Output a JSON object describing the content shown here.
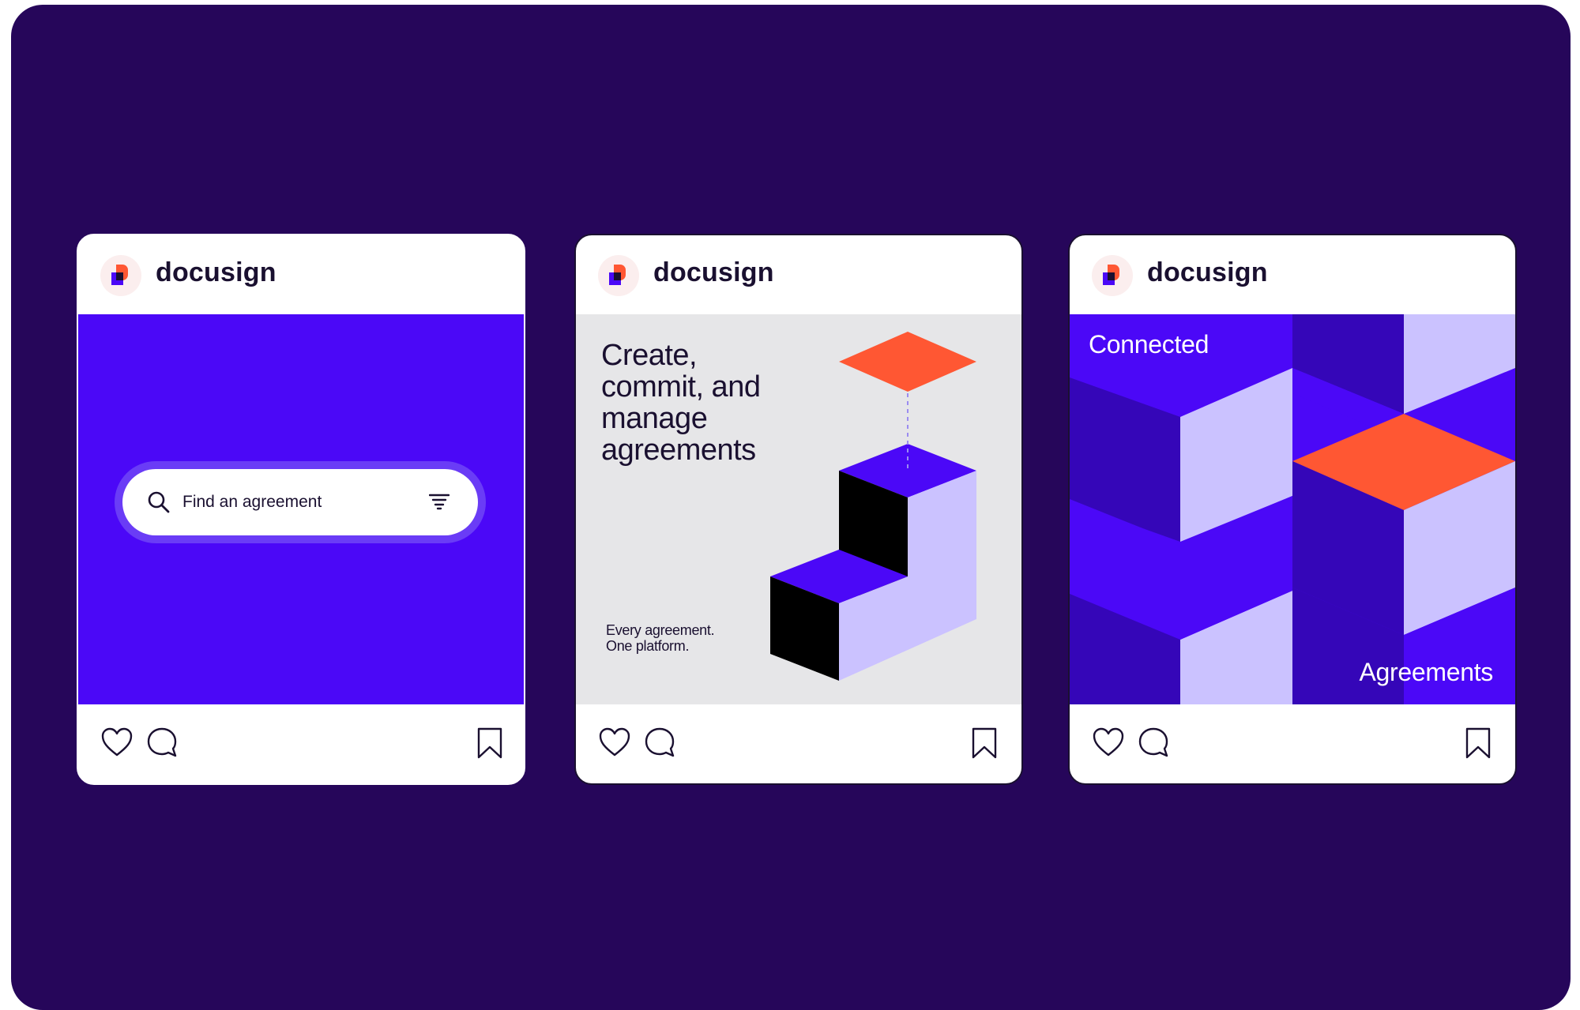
{
  "brand_colors": {
    "background": "#26065a",
    "cobalt": "#4b08f7",
    "lavender": "#cbc2ff",
    "coral": "#ff5733",
    "ink": "#1a1030"
  },
  "posts": [
    {
      "brand": "docusign",
      "search": {
        "placeholder": "Find an agreement",
        "search_icon": "search-icon",
        "filter_icon": "filter-icon"
      },
      "actions": [
        "heart-icon",
        "comment-icon",
        "bookmark-icon"
      ]
    },
    {
      "brand": "docusign",
      "headline": "Create, commit, and manage agreements",
      "tagline": "Every agreement. One platform.",
      "actions": [
        "heart-icon",
        "comment-icon",
        "bookmark-icon"
      ]
    },
    {
      "brand": "docusign",
      "top_label": "Connected",
      "bottom_label": "Agreements",
      "actions": [
        "heart-icon",
        "comment-icon",
        "bookmark-icon"
      ]
    }
  ]
}
